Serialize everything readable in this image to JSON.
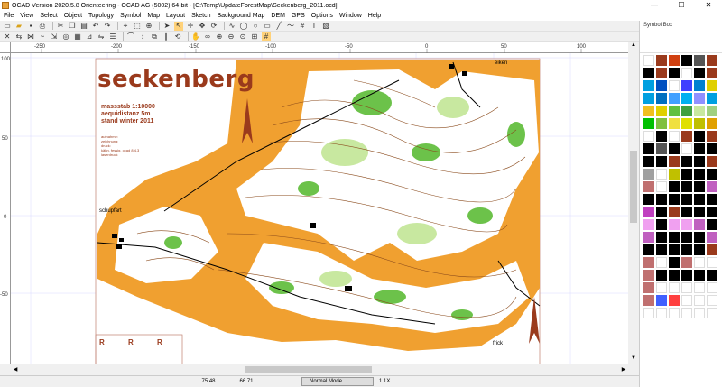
{
  "window": {
    "title": "OCAD Version 2020.5.8 Orienteering - OCAD AG (5002) 64-bit - [C:\\Temp\\UpdateForestMap\\Seckenberg_2011.ocd]",
    "minimize": "—",
    "maximize": "☐",
    "close": "✕"
  },
  "menu": [
    "File",
    "View",
    "Select",
    "Object",
    "Topology",
    "Symbol",
    "Map",
    "Layout",
    "Sketch",
    "Background Map",
    "DEM",
    "GPS",
    "Options",
    "Window",
    "Help"
  ],
  "ruler": {
    "top_ticks": [
      "-250",
      "-200",
      "-150",
      "-100",
      "-50",
      "0",
      "50",
      "100"
    ],
    "left_ticks": [
      "100",
      "50",
      "0",
      "-50"
    ]
  },
  "symbol_box": {
    "title": "Symbol Box"
  },
  "map": {
    "title": "seckenberg",
    "info_lines": [
      "massstab 1:10000",
      "aequidistanz    5m",
      "stand  winter  2011"
    ],
    "credits": [
      "aufnahme:",
      "zeichnung:",
      "druck:",
      "kähn, fessig, ocad 8 4.3",
      "laserdruck"
    ],
    "places": [
      "schupfart",
      "eiken",
      "frick"
    ],
    "r_marks": [
      "R",
      "R",
      "R"
    ]
  },
  "status": {
    "x": "75.48",
    "y": "66.71",
    "mode": "Normal Mode",
    "zoom": "1.1X"
  },
  "colors": {
    "forest_orange": "#f0a030",
    "map_brown": "#9a3a1c",
    "green": "#6cc24a",
    "light_green": "#c8e8a0"
  }
}
